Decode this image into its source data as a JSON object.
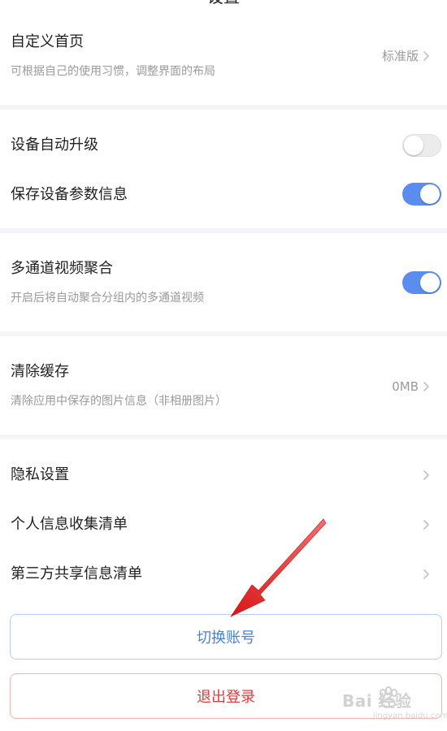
{
  "header": {
    "title": "设置"
  },
  "sections": {
    "homepage": {
      "title": "自定义首页",
      "subtitle": "可根据自己的使用习惯，调整界面的布局",
      "value": "标准版"
    },
    "device_auto_upgrade": {
      "title": "设备自动升级",
      "enabled": false
    },
    "save_device_params": {
      "title": "保存设备参数信息",
      "enabled": true
    },
    "multi_channel": {
      "title": "多通道视频聚合",
      "subtitle": "开启后将自动聚合分组内的多通道视频",
      "enabled": true
    },
    "clear_cache": {
      "title": "清除缓存",
      "subtitle": "清除应用中保存的图片信息（非相册图片）",
      "value": "0MB"
    },
    "privacy": {
      "title": "隐私设置"
    },
    "personal_info": {
      "title": "个人信息收集清单"
    },
    "third_party": {
      "title": "第三方共享信息清单"
    }
  },
  "buttons": {
    "switch_account": "切换账号",
    "logout": "退出登录"
  },
  "watermark": {
    "main": "Bai 经验",
    "sub": "jingyan.baidu.com"
  },
  "colors": {
    "accent": "#5b8def",
    "danger": "#e23b3b",
    "annotation_arrow": "#e02020"
  }
}
